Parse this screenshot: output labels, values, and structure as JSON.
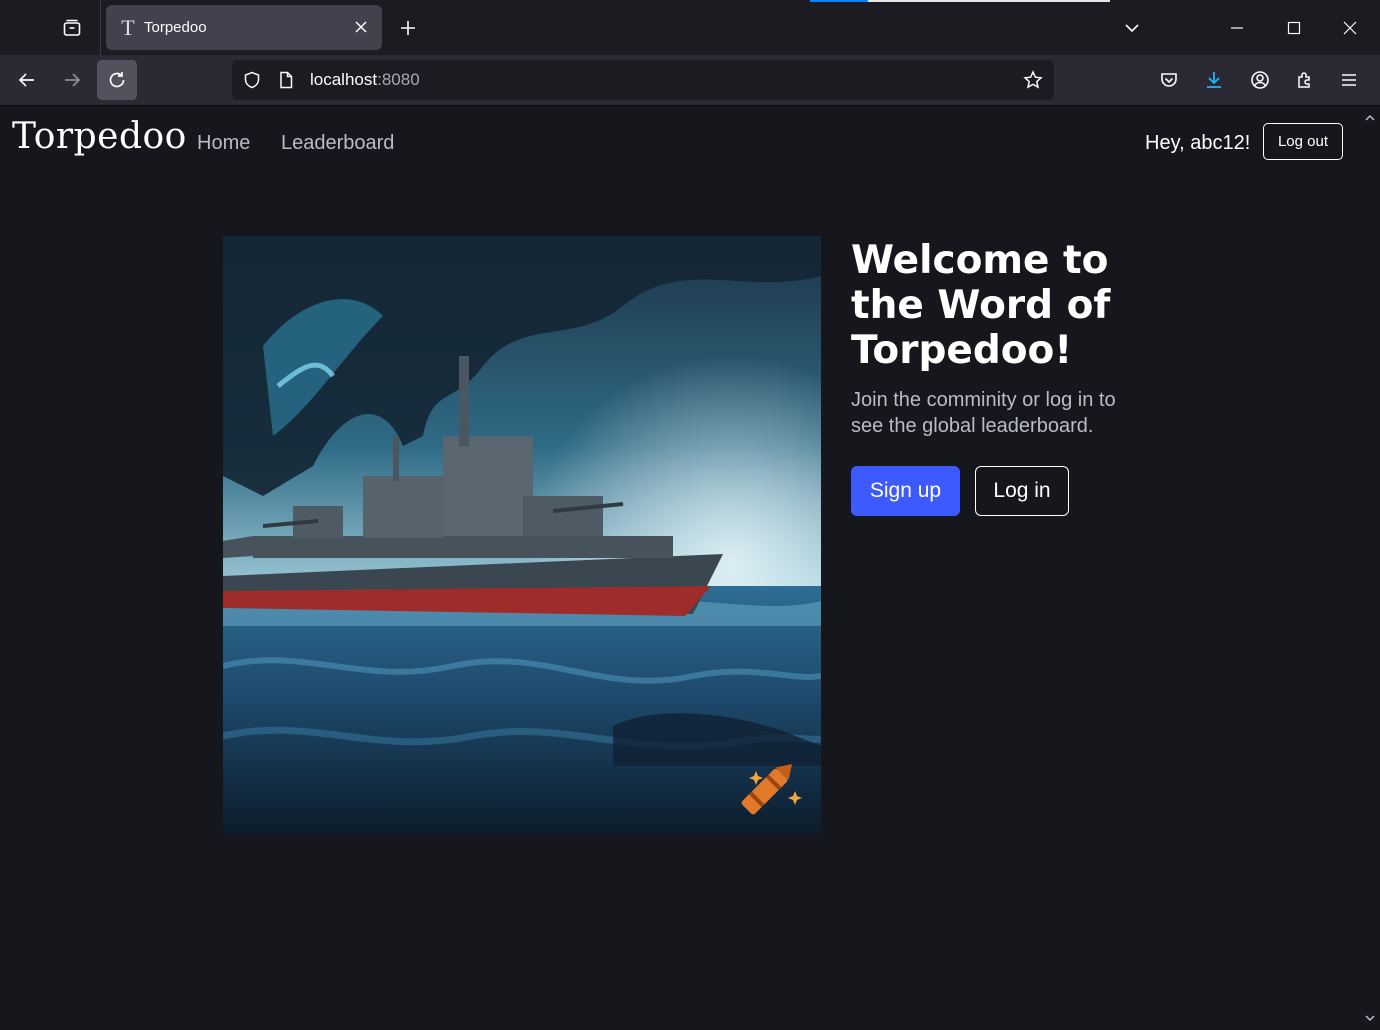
{
  "browser": {
    "tab": {
      "favicon_letter": "T",
      "title": "Torpedoo"
    },
    "url": {
      "host": "localhost",
      "port": ":8080"
    },
    "icons": [
      "tab-list-icon",
      "close-icon",
      "plus-icon",
      "chevron-down-icon",
      "minimize-icon",
      "maximize-icon",
      "window-close-icon",
      "back-icon",
      "forward-icon",
      "reload-icon",
      "shield-icon",
      "page-icon",
      "star-icon",
      "pocket-icon",
      "download-icon",
      "account-icon",
      "extensions-icon",
      "menu-icon"
    ],
    "colors": {
      "download_accent": "#1fb6ff",
      "tab_active_bg": "#42414d"
    }
  },
  "site": {
    "brand": "Torpedoo",
    "nav": {
      "home": "Home",
      "leaderboard": "Leaderboard"
    },
    "greeting": "Hey, abc12!",
    "logout_label": "Log out"
  },
  "hero": {
    "title": "Welcome to the Word of Torpedoo!",
    "subtitle": "Join the comminity or log in to see the global leaderboard.",
    "signup_label": "Sign up",
    "login_label": "Log in",
    "image_alt": "battleship-painting",
    "colors": {
      "signup_bg": "#3d5afe",
      "page_bg": "#16171c"
    }
  }
}
